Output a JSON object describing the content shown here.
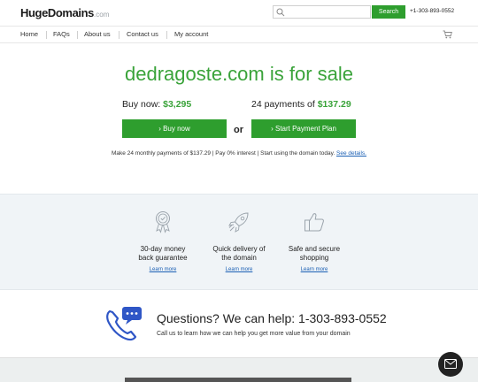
{
  "header": {
    "logo_main": "HugeDomains",
    "logo_suffix": ".com",
    "search_placeholder": "",
    "search_button": "Search",
    "phone": "+1-303-893-0552"
  },
  "nav": {
    "items": [
      "Home",
      "FAQs",
      "About us",
      "Contact us",
      "My account"
    ]
  },
  "hero": {
    "title": "dedragoste.com is for sale",
    "buy_now_label": "Buy now:",
    "buy_now_price": "$3,295",
    "payments_label": "24 payments of",
    "payments_price": "$137.29",
    "buy_button": "› Buy now",
    "or": "or",
    "plan_button": "› Start Payment Plan",
    "info_text": "Make 24 monthly payments of $137.29 | Pay 0% interest | Start using the domain today.",
    "info_link": "See details."
  },
  "features": [
    {
      "icon": "award-ribbon-icon",
      "title_line1": "30-day money",
      "title_line2": "back guarantee",
      "link": "Learn more"
    },
    {
      "icon": "rocket-icon",
      "title_line1": "Quick delivery of",
      "title_line2": "the domain",
      "link": "Learn more"
    },
    {
      "icon": "thumbs-up-icon",
      "title_line1": "Safe and secure",
      "title_line2": "shopping",
      "link": "Learn more"
    }
  ],
  "questions": {
    "title": "Questions? We can help: 1-303-893-0552",
    "subtitle": "Call us to learn how we can help you get more value from your domain"
  },
  "colors": {
    "brand_green": "#2e9e2e",
    "title_green": "#3aa33a",
    "link_blue": "#1a5fb4",
    "icon_blue": "#2f56c6"
  }
}
